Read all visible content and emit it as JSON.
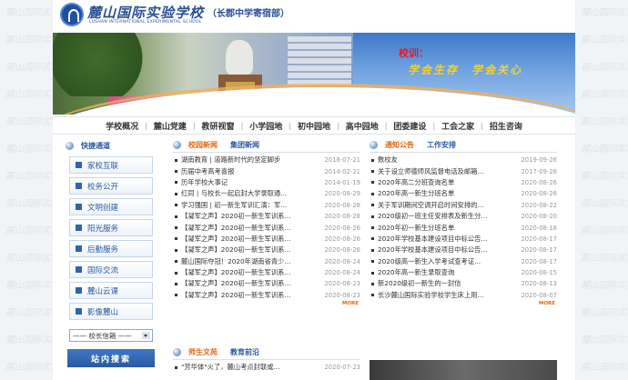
{
  "header": {
    "school_name": "麓山国际实验学校",
    "school_en": "LUSHAN INTERNATIONAL EXPERIMENTAL SCHOOL",
    "campus": "（长郡中学寄宿部）"
  },
  "banner": {
    "motto_label": "校训：",
    "motto_text": "学会生存　学会关心"
  },
  "nav": [
    "学校概况",
    "麓山党建",
    "教研视窗",
    "小学园地",
    "初中园地",
    "高中园地",
    "团委建设",
    "工会之家",
    "招生咨询"
  ],
  "sidebar": {
    "title": "快捷通道",
    "items": [
      "家校互联",
      "校务公开",
      "文明创建",
      "阳光服务",
      "后勤服务",
      "国际交流",
      "麓山云课",
      "影像麓山"
    ],
    "select_value": "—— 校长信箱 ——",
    "search_title": "站内搜索"
  },
  "news": {
    "tabs": [
      "校园新闻",
      "集团新闻"
    ],
    "rows": [
      {
        "title": "湖南教育 | 道路新时代的坚定脚步",
        "date": "2018-07-21"
      },
      {
        "title": "历届中考高考喜报",
        "date": "2014-02-21"
      },
      {
        "title": "历年学校大事记",
        "date": "2014-01-19"
      },
      {
        "title": "红同 | 与校长一起启封大学录取通...",
        "date": "2020-08-29"
      },
      {
        "title": "学习强国 | 初一新生军训汇演：军...",
        "date": "2020-08-28"
      },
      {
        "title": "【凝军之声】2020初一新生军训系...",
        "date": "2020-08-28"
      },
      {
        "title": "【凝军之声】2020初一新生军训系...",
        "date": "2020-08-26"
      },
      {
        "title": "【凝军之声】2020初一新生军训系...",
        "date": "2020-08-26"
      },
      {
        "title": "【凝军之声】2020初一新生军训系...",
        "date": "2020-08-26"
      },
      {
        "title": "麓山国际夺冠！2020年湖南省青少...",
        "date": "2020-08-24"
      },
      {
        "title": "【凝军之声】2020初一新生军训系...",
        "date": "2020-08-24"
      },
      {
        "title": "【凝军之声】2020初一新生军训系...",
        "date": "2020-08-23"
      },
      {
        "title": "【凝军之声】2020初一新生军训系...",
        "date": "2020-08-23"
      }
    ],
    "more": "MORE"
  },
  "notices": {
    "tabs": [
      "通知公告",
      "工作安排"
    ],
    "rows": [
      {
        "title": "数校友",
        "date": "2019-09-26"
      },
      {
        "title": "关于设立师德师风监督电话及邮箱...",
        "date": "2017-09-26"
      },
      {
        "title": "2020年高二分班查询名单",
        "date": "2020-08-26"
      },
      {
        "title": "2020年高一新生分班名单",
        "date": "2020-08-26"
      },
      {
        "title": "关于军训期间空调开启时间安排的...",
        "date": "2020-08-22"
      },
      {
        "title": "2020级初一班主任安排表及新生分...",
        "date": "2020-08-20"
      },
      {
        "title": "2020年初一新生分班名单",
        "date": "2020-08-18"
      },
      {
        "title": "2020年学校基本建设项目中标公告...",
        "date": "2020-08-17"
      },
      {
        "title": "2020年学校基本建设项目中标公告...",
        "date": "2020-08-17"
      },
      {
        "title": "2020级高一新生入学考试查考证...",
        "date": "2020-08-17"
      },
      {
        "title": "2020年高一新生录取查询",
        "date": "2020-08-15"
      },
      {
        "title": "新2020级初一新生的一封信",
        "date": "2020-08-13"
      },
      {
        "title": "长沙麓山国际实验学校学生床上用...",
        "date": "2020-08-07"
      }
    ],
    "more": "MORE"
  },
  "teachers": {
    "tabs": [
      "师生文苑",
      "教育前沿"
    ],
    "rows": [
      {
        "title": "\"芳华体\"火了，麓山考点封联或...",
        "date": "2020-07-23"
      }
    ]
  },
  "watermark": "麓山国际实验学校"
}
